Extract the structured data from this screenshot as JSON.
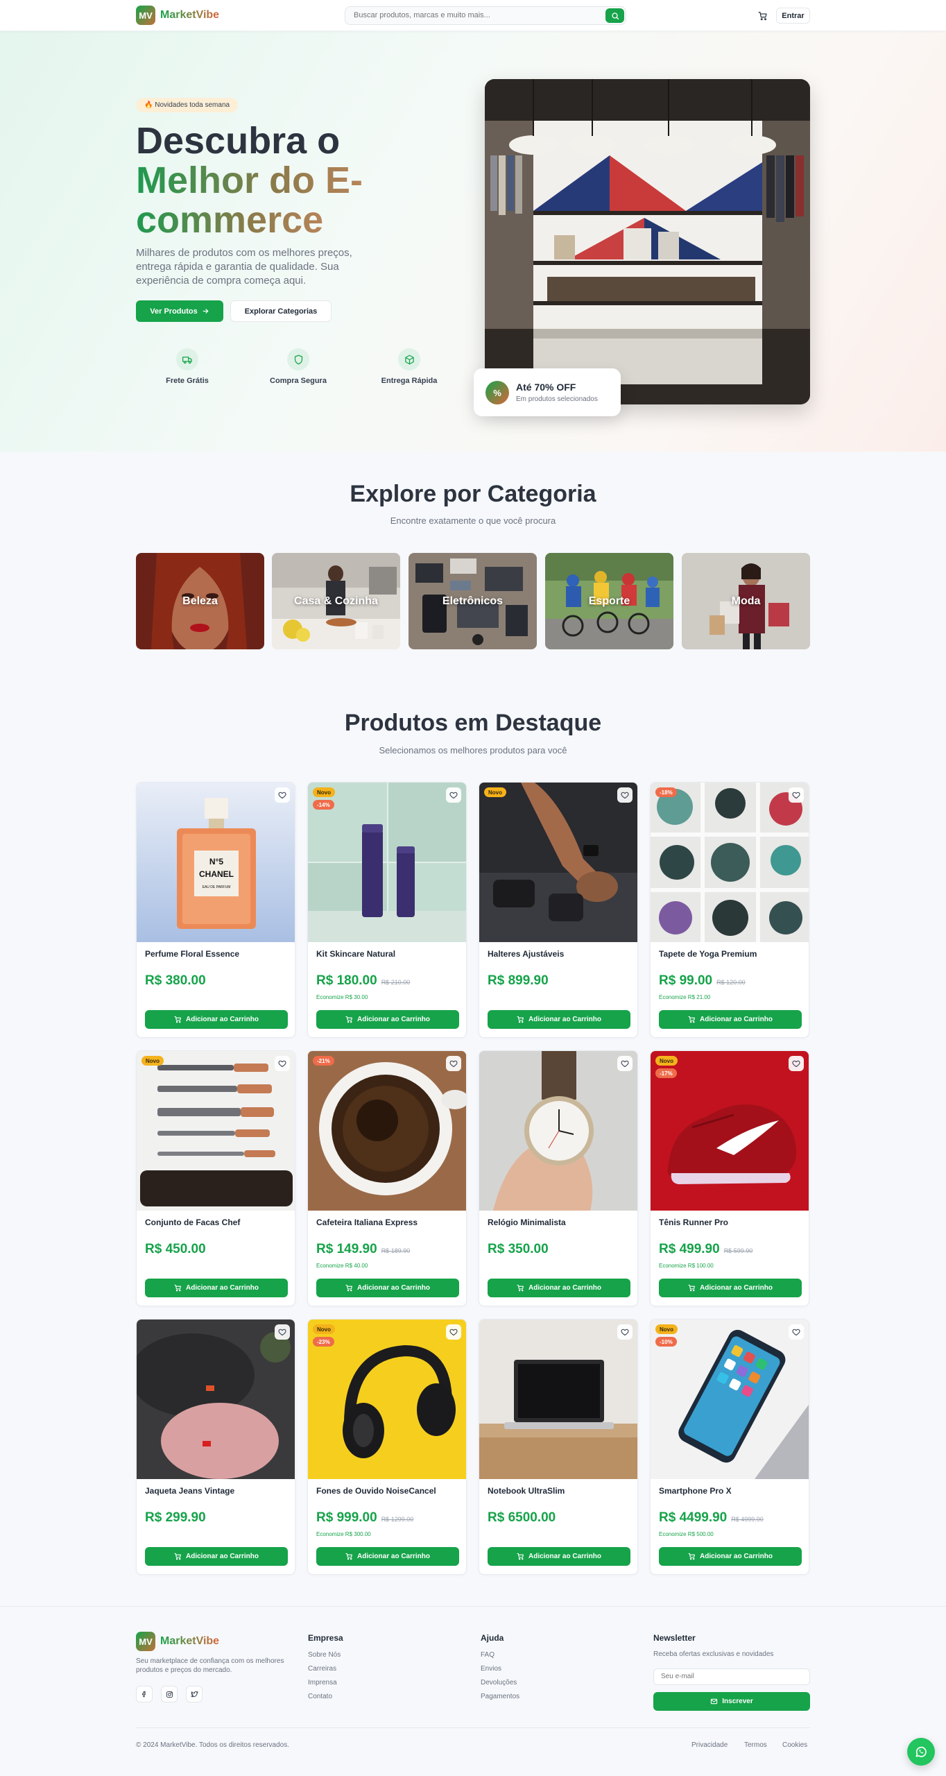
{
  "brand": {
    "initials": "MV",
    "name": "MarketVibe"
  },
  "header": {
    "search_placeholder": "Buscar produtos, marcas e muito mais...",
    "login_label": "Entrar"
  },
  "hero": {
    "tag": "🔥 Novidades toda semana",
    "title_line1": "Descubra o",
    "title_line2": "Melhor do E-",
    "title_line3": "commerce",
    "description": "Milhares de produtos com os melhores preços, entrega rápida e garantia de qualidade. Sua experiência de compra começa aqui.",
    "primary_button": "Ver Produtos",
    "secondary_button": "Explorar Categorias",
    "features": [
      {
        "label": "Frete Grátis",
        "icon": "truck-icon"
      },
      {
        "label": "Compra Segura",
        "icon": "shield-icon"
      },
      {
        "label": "Entrega Rápida",
        "icon": "package-icon"
      }
    ],
    "promo": {
      "badge": "%",
      "title": "Até 70% OFF",
      "subtitle": "Em produtos selecionados"
    }
  },
  "categories": {
    "title": "Explore por Categoria",
    "subtitle": "Encontre exatamente o que você procura",
    "items": [
      {
        "label": "Beleza"
      },
      {
        "label": "Casa & Cozinha"
      },
      {
        "label": "Eletrônicos"
      },
      {
        "label": "Esporte"
      },
      {
        "label": "Moda"
      }
    ]
  },
  "products": {
    "title": "Produtos em Destaque",
    "subtitle": "Selecionamos os melhores produtos para você",
    "add_label": "Adicionar ao Carrinho",
    "new_label": "Novo",
    "items": [
      {
        "name": "Perfume Floral Essence",
        "price": "R$ 380.00",
        "old_price": "",
        "savings": "",
        "is_new": false,
        "discount": ""
      },
      {
        "name": "Kit Skincare Natural",
        "price": "R$ 180.00",
        "old_price": "R$ 210.00",
        "savings": "Economize R$ 30.00",
        "is_new": true,
        "discount": "-14%"
      },
      {
        "name": "Halteres Ajustáveis",
        "price": "R$ 899.90",
        "old_price": "",
        "savings": "",
        "is_new": true,
        "discount": ""
      },
      {
        "name": "Tapete de Yoga Premium",
        "price": "R$ 99.00",
        "old_price": "R$ 120.00",
        "savings": "Economize R$ 21.00",
        "is_new": false,
        "discount": "-18%"
      },
      {
        "name": "Conjunto de Facas Chef",
        "price": "R$ 450.00",
        "old_price": "",
        "savings": "",
        "is_new": true,
        "discount": ""
      },
      {
        "name": "Cafeteira Italiana Express",
        "price": "R$ 149.90",
        "old_price": "R$ 189.90",
        "savings": "Economize R$ 40.00",
        "is_new": false,
        "discount": "-21%"
      },
      {
        "name": "Relógio Minimalista",
        "price": "R$ 350.00",
        "old_price": "",
        "savings": "",
        "is_new": false,
        "discount": ""
      },
      {
        "name": "Tênis Runner Pro",
        "price": "R$ 499.90",
        "old_price": "R$ 599.90",
        "savings": "Economize R$ 100.00",
        "is_new": true,
        "discount": "-17%"
      },
      {
        "name": "Jaqueta Jeans Vintage",
        "price": "R$ 299.90",
        "old_price": "",
        "savings": "",
        "is_new": false,
        "discount": ""
      },
      {
        "name": "Fones de Ouvido NoiseCancel",
        "price": "R$ 999.00",
        "old_price": "R$ 1299.00",
        "savings": "Economize R$ 300.00",
        "is_new": true,
        "discount": "-23%"
      },
      {
        "name": "Notebook UltraSlim",
        "price": "R$ 6500.00",
        "old_price": "",
        "savings": "",
        "is_new": false,
        "discount": ""
      },
      {
        "name": "Smartphone Pro X",
        "price": "R$ 4499.90",
        "old_price": "R$ 4999.90",
        "savings": "Economize R$ 500.00",
        "is_new": true,
        "discount": "-10%"
      }
    ]
  },
  "footer": {
    "description": "Seu marketplace de confiança com os melhores produtos e preços do mercado.",
    "company_title": "Empresa",
    "company_links": [
      "Sobre Nós",
      "Carreiras",
      "Imprensa",
      "Contato"
    ],
    "help_title": "Ajuda",
    "help_links": [
      "FAQ",
      "Envios",
      "Devoluções",
      "Pagamentos"
    ],
    "newsletter_title": "Newsletter",
    "newsletter_desc": "Receba ofertas exclusivas e novidades",
    "newsletter_placeholder": "Seu e-mail",
    "newsletter_button": "Inscrever",
    "copyright": "© 2024 MarketVibe. Todos os direitos reservados.",
    "legal_links": [
      "Privacidade",
      "Termos",
      "Cookies"
    ]
  },
  "colors": {
    "primary": "#16a34a",
    "accent": "#d9663a",
    "new_badge": "#f4b21b",
    "discount_badge": "#ef6c4a",
    "heading": "#2d3440"
  }
}
